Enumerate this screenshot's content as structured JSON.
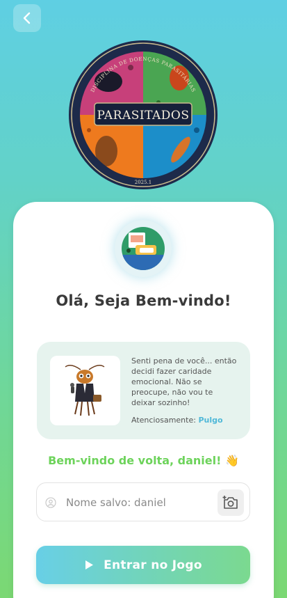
{
  "header": {
    "back_icon": "chevron-left-icon"
  },
  "logo": {
    "top_text": "DISCIPLINA DE DOENÇAS PARASITÁRIAS",
    "title": "PARASITADOS",
    "year": "2025.1"
  },
  "greeting": "Olá, Seja Bem-vindo!",
  "message": {
    "text": "Senti pena de você... então decidi fazer caridade emocional. Não se preocupe, não vou te deixar sozinho!",
    "sign_prefix": "Atenciosamente:",
    "author": "Pulgo"
  },
  "welcome_back": "Bem-vindo de volta, daniel! 👋",
  "name_input": {
    "placeholder": "Nome salvo: daniel",
    "value": ""
  },
  "play_button": {
    "label": "Entrar no Jogo",
    "icon": "play-icon"
  },
  "colors": {
    "accent_green": "#6dd35b",
    "accent_blue": "#4fb8d8"
  }
}
